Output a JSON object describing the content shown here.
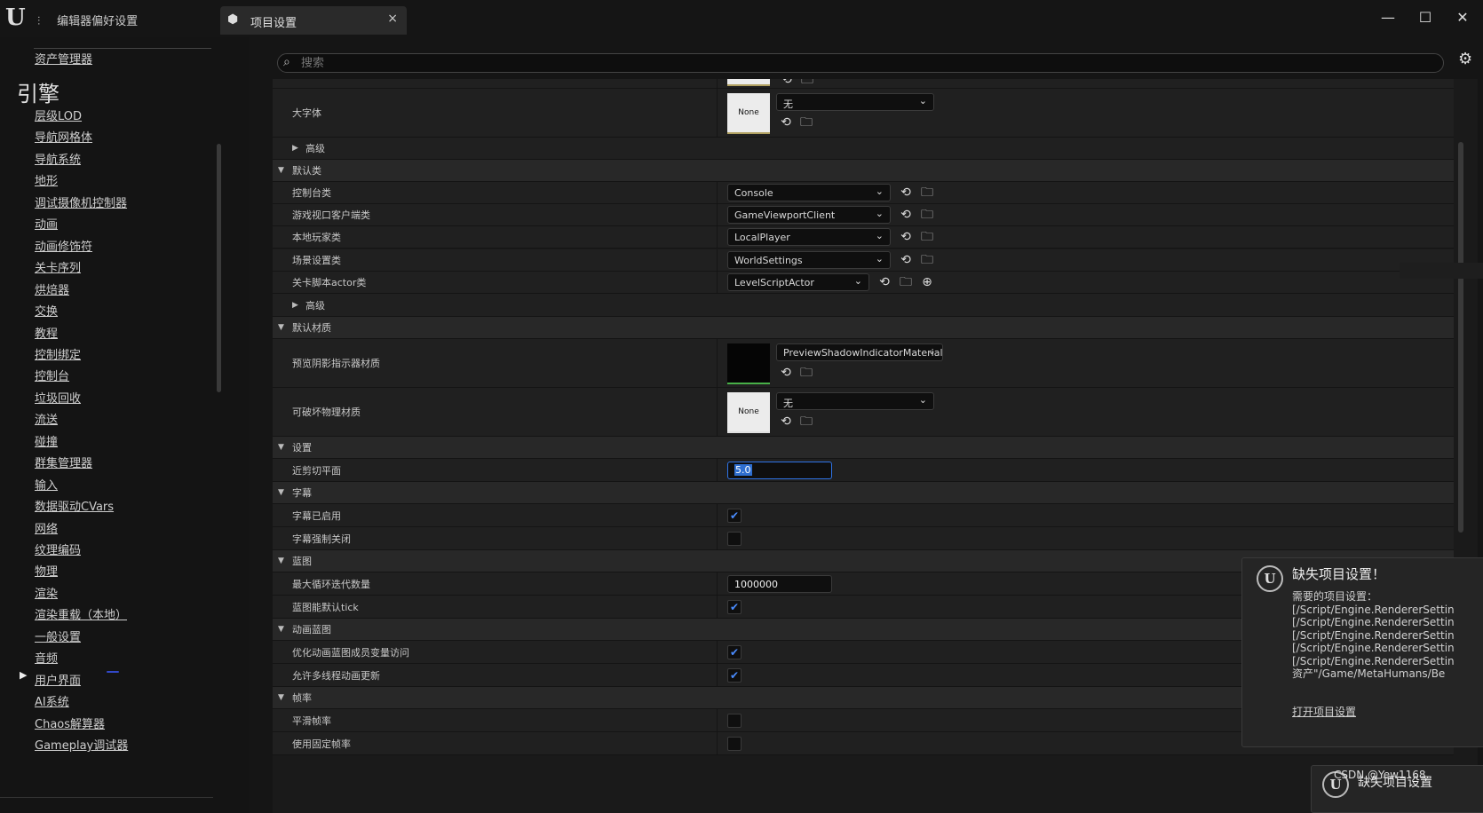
{
  "titlebar": {
    "editor_prefs": "编辑器偏好设置",
    "tab_label": "项目设置",
    "close": "×",
    "minimize": "—",
    "maximize": "☐",
    "win_close": "✕"
  },
  "sidebar": {
    "top_item": "资产管理器",
    "section": "引擎",
    "items": [
      "层级LOD",
      "导航网格体",
      "导航系统",
      "地形",
      "调试摄像机控制器",
      "动画",
      "动画修饰符",
      "关卡序列",
      "烘焙器",
      "交换",
      "教程",
      "控制绑定",
      "控制台",
      "垃圾回收",
      "流送",
      "碰撞",
      "群集管理器",
      "输入",
      "数据驱动CVars",
      "网络",
      "纹理编码",
      "物理",
      "渲染",
      "渲染重载（本地）",
      "一般设置",
      "音频",
      "用户界面",
      "AI系统",
      "Chaos解算器",
      "Gameplay调试器"
    ],
    "selected": "一般设置"
  },
  "search": {
    "placeholder": "搜索"
  },
  "panel": {
    "big_font_label": "大字体",
    "none_thumb": "None",
    "none_option": "无",
    "advanced": "高级",
    "default_classes": {
      "label": "默认类",
      "rows": [
        {
          "label": "控制台类",
          "value": "Console"
        },
        {
          "label": "游戏视口客户端类",
          "value": "GameViewportClient"
        },
        {
          "label": "本地玩家类",
          "value": "LocalPlayer"
        },
        {
          "label": "场景设置类",
          "value": "WorldSettings"
        },
        {
          "label": "关卡脚本actor类",
          "value": "LevelScriptActor"
        }
      ]
    },
    "default_materials": {
      "label": "默认材质",
      "preview_shadow_label": "预览阴影指示器材质",
      "preview_shadow_value": "PreviewShadowIndicatorMaterial",
      "destructible_label": "可破坏物理材质"
    },
    "settings": {
      "label": "设置",
      "near_clip_label": "近剪切平面",
      "near_clip_value": "5.0"
    },
    "subtitles": {
      "label": "字幕",
      "enabled_label": "字幕已启用",
      "enabled": true,
      "force_off_label": "字幕强制关闭",
      "force_off": false
    },
    "blueprint": {
      "label": "蓝图",
      "max_loop_label": "最大循环迭代数量",
      "max_loop_value": "1000000",
      "tick_label": "蓝图能默认tick",
      "tick": true
    },
    "anim_blueprint": {
      "label": "动画蓝图",
      "optimize_label": "优化动画蓝图成员变量访问",
      "optimize": true,
      "multithread_label": "允许多线程动画更新",
      "multithread": true
    },
    "framerate": {
      "label": "帧率",
      "smooth_label": "平滑帧率",
      "smooth": false,
      "fixed_label": "使用固定帧率",
      "fixed": false
    }
  },
  "toast": {
    "title": "缺失项目设置！",
    "body_lines": [
      "需要的项目设置：",
      "[/Script/Engine.RendererSettin",
      "[/Script/Engine.RendererSettin",
      "[/Script/Engine.RendererSettin",
      "[/Script/Engine.RendererSettin",
      "[/Script/Engine.RendererSettin",
      "资产\"/Game/MetaHumans/Be"
    ],
    "link": "打开项目设置",
    "second_title": "缺失项目设置"
  },
  "watermark": "CSDN @Yew1168",
  "icons": {
    "ue_logo": "ue-logo-icon",
    "search": "search-icon",
    "gear": "gear-icon",
    "reset": "reset-arrow-icon",
    "browse": "browse-folder-icon",
    "add": "add-circle-icon",
    "check": "checkmark-icon",
    "chevron": "chevron-down-icon",
    "expand": "expand-triangle-icon",
    "collapse": "collapse-triangle-icon"
  },
  "colors": {
    "focus": "#2f74e8",
    "check": "#4a8cff",
    "accent_line": "#3248c8"
  }
}
